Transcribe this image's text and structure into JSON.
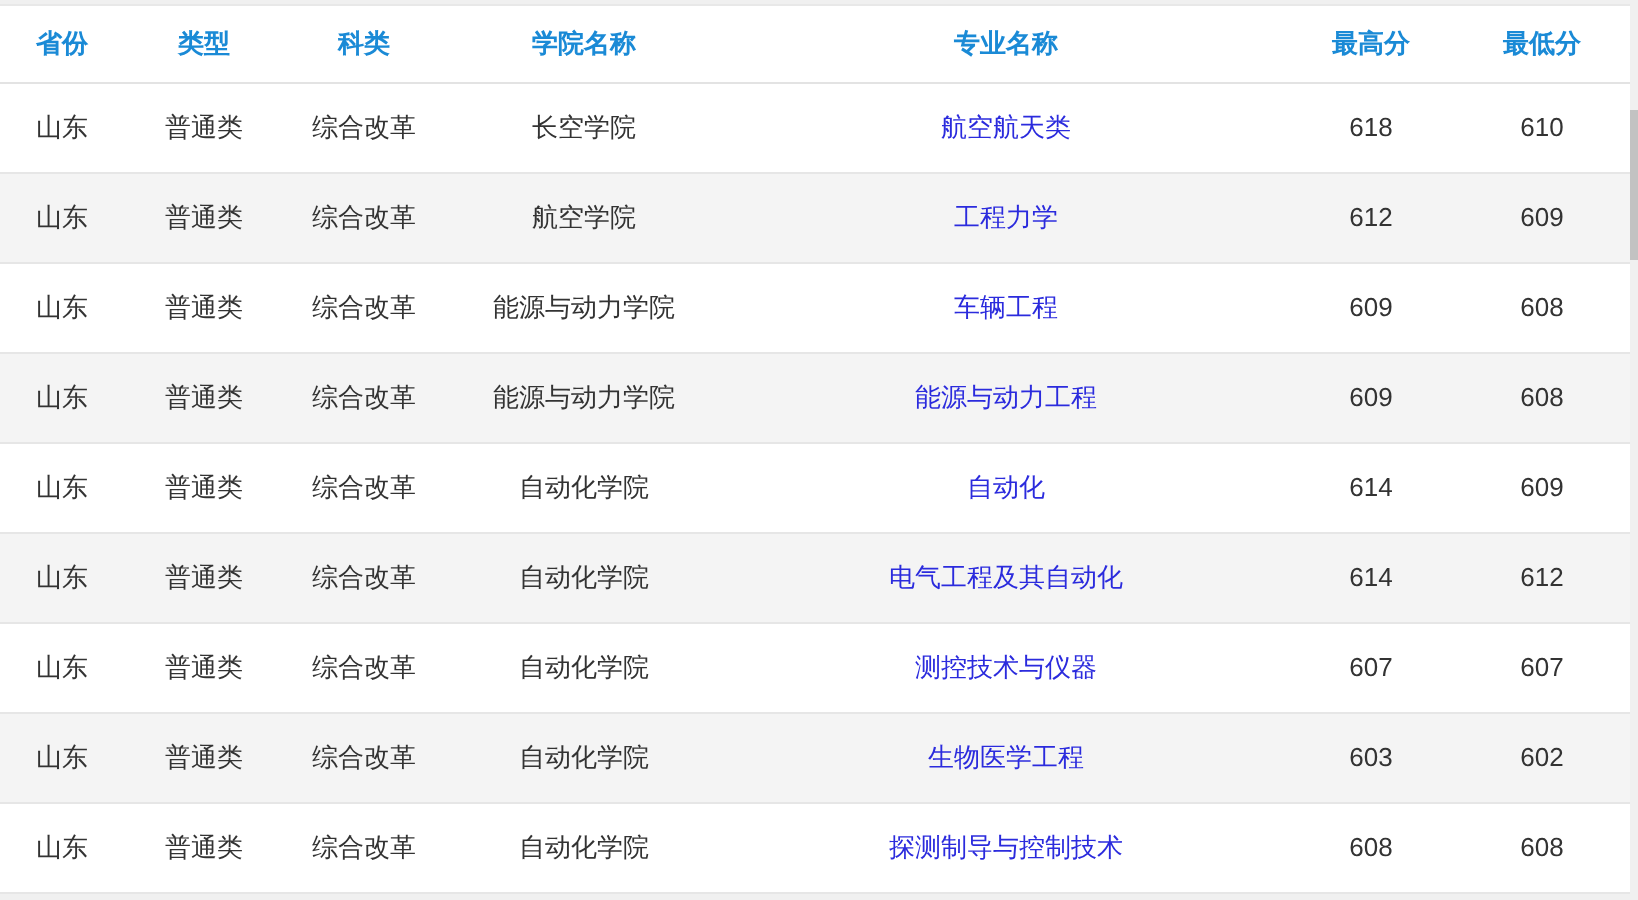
{
  "table": {
    "columns": [
      "省份",
      "类型",
      "科类",
      "学院名称",
      "专业名称",
      "最高分",
      "最低分"
    ],
    "rows": [
      {
        "province": "山东",
        "type": "普通类",
        "category": "综合改革",
        "college": "长空学院",
        "major": "航空航天类",
        "max": "618",
        "min": "610"
      },
      {
        "province": "山东",
        "type": "普通类",
        "category": "综合改革",
        "college": "航空学院",
        "major": "工程力学",
        "max": "612",
        "min": "609"
      },
      {
        "province": "山东",
        "type": "普通类",
        "category": "综合改革",
        "college": "能源与动力学院",
        "major": "车辆工程",
        "max": "609",
        "min": "608"
      },
      {
        "province": "山东",
        "type": "普通类",
        "category": "综合改革",
        "college": "能源与动力学院",
        "major": "能源与动力工程",
        "max": "609",
        "min": "608"
      },
      {
        "province": "山东",
        "type": "普通类",
        "category": "综合改革",
        "college": "自动化学院",
        "major": "自动化",
        "max": "614",
        "min": "609"
      },
      {
        "province": "山东",
        "type": "普通类",
        "category": "综合改革",
        "college": "自动化学院",
        "major": "电气工程及其自动化",
        "max": "614",
        "min": "612"
      },
      {
        "province": "山东",
        "type": "普通类",
        "category": "综合改革",
        "college": "自动化学院",
        "major": "测控技术与仪器",
        "max": "607",
        "min": "607"
      },
      {
        "province": "山东",
        "type": "普通类",
        "category": "综合改革",
        "college": "自动化学院",
        "major": "生物医学工程",
        "max": "603",
        "min": "602"
      },
      {
        "province": "山东",
        "type": "普通类",
        "category": "综合改革",
        "college": "自动化学院",
        "major": "探测制导与控制技术",
        "max": "608",
        "min": "608"
      }
    ]
  }
}
